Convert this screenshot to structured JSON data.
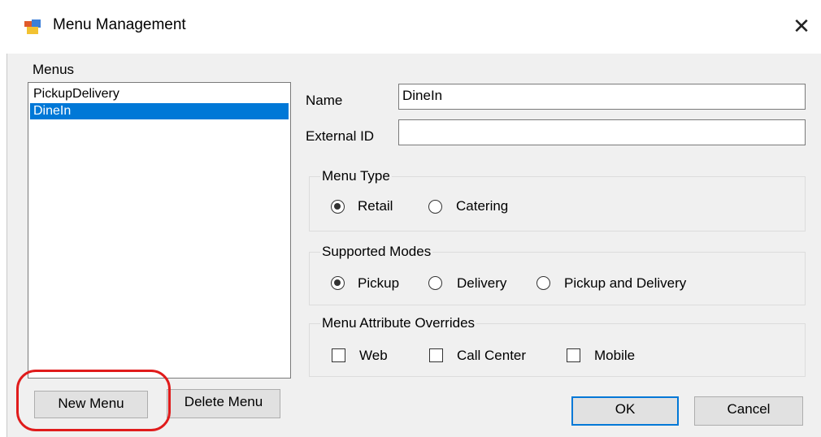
{
  "window": {
    "title": "Menu Management",
    "close_glyph": "✕"
  },
  "menus": {
    "label": "Menus",
    "items": [
      {
        "label": "PickupDelivery",
        "selected": false
      },
      {
        "label": "DineIn",
        "selected": true
      }
    ]
  },
  "form": {
    "name_label": "Name",
    "name_value": "DineIn",
    "external_id_label": "External ID",
    "external_id_value": ""
  },
  "menu_type": {
    "title": "Menu Type",
    "options": [
      {
        "label": "Retail",
        "checked": true
      },
      {
        "label": "Catering",
        "checked": false
      }
    ]
  },
  "supported_modes": {
    "title": "Supported Modes",
    "options": [
      {
        "label": "Pickup",
        "checked": true
      },
      {
        "label": "Delivery",
        "checked": false
      },
      {
        "label": "Pickup and Delivery",
        "checked": false
      }
    ]
  },
  "overrides": {
    "title": "Menu Attribute Overrides",
    "options": [
      {
        "label": "Web",
        "checked": false
      },
      {
        "label": "Call Center",
        "checked": false
      },
      {
        "label": "Mobile",
        "checked": false
      }
    ]
  },
  "buttons": {
    "new_menu": "New Menu",
    "delete_menu": "Delete Menu",
    "ok": "OK",
    "cancel": "Cancel"
  },
  "colors": {
    "selection": "#0078d7",
    "annotation": "#e01b1b",
    "dialog_bg": "#f0f0f0"
  },
  "icons": [
    "app-window-icon",
    "close-icon"
  ]
}
